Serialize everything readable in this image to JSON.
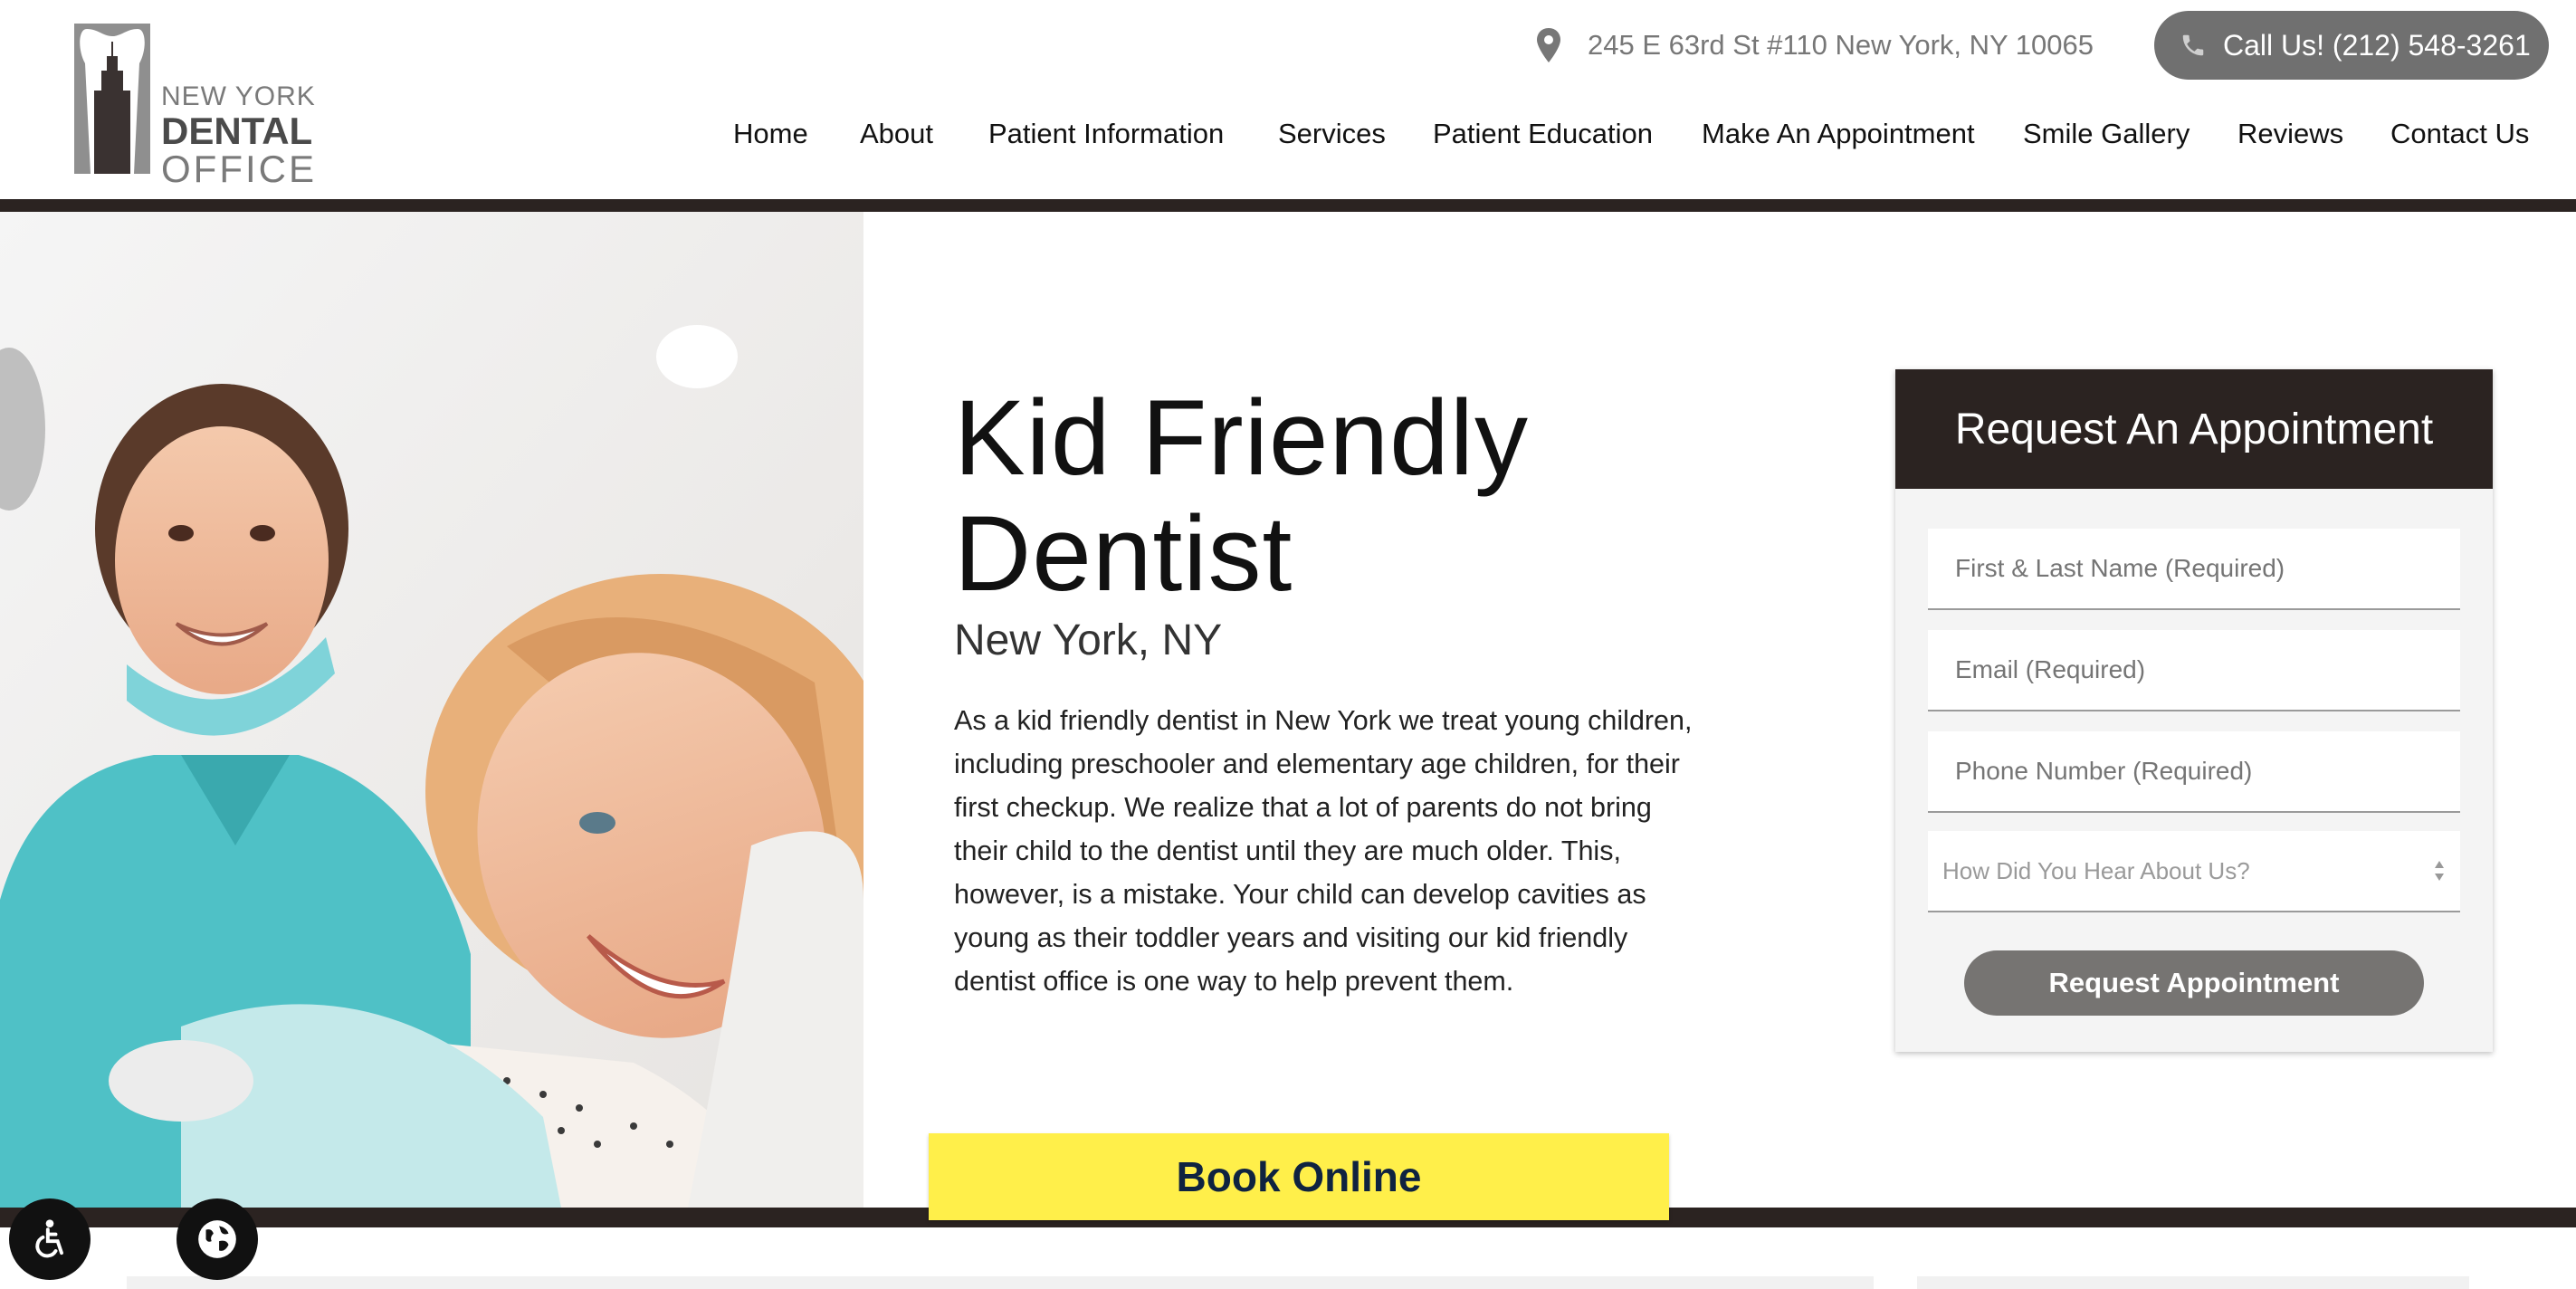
{
  "header": {
    "logo": {
      "line1": "NEW YORK",
      "line2": "DENTAL",
      "line3": "OFFICE"
    },
    "address": "245 E 63rd St #110 New York, NY 10065",
    "call_label": "Call Us! (212) 548-3261",
    "icons": {
      "address": "map-pin-icon",
      "call": "phone-icon"
    }
  },
  "nav": {
    "items": [
      {
        "label": "Home"
      },
      {
        "label": "About"
      },
      {
        "label": "Patient Information"
      },
      {
        "label": "Services"
      },
      {
        "label": "Patient Education"
      },
      {
        "label": "Make An Appointment"
      },
      {
        "label": "Smile Gallery"
      },
      {
        "label": "Reviews"
      },
      {
        "label": "Contact Us"
      }
    ]
  },
  "hero": {
    "title_line1": "Kid Friendly",
    "title_line2": "Dentist",
    "subtitle": "New York, NY",
    "body": "As a kid friendly dentist in New York we treat young children, including preschooler and elementary age children, for their first checkup. We realize that a lot of parents do not bring their child to the dentist until they are much older. This, however, is a mistake. Your child can develop cavities as young as their toddler years and visiting our kid friendly dentist office is one way to help prevent them.",
    "book_label": "Book Online"
  },
  "form": {
    "title": "Request An Appointment",
    "name_placeholder": "First & Last Name (Required)",
    "email_placeholder": "Email (Required)",
    "phone_placeholder": "Phone Number (Required)",
    "hear_about": "How Did You Hear About Us?",
    "submit_label": "Request Appointment"
  },
  "floating": {
    "accessibility_icon": "wheelchair-icon",
    "language_icon": "globe-icon"
  },
  "colors": {
    "dark": "#2b2321",
    "button_gray": "#767472",
    "book_yellow": "#ffef4a",
    "book_text": "#0f2340"
  }
}
